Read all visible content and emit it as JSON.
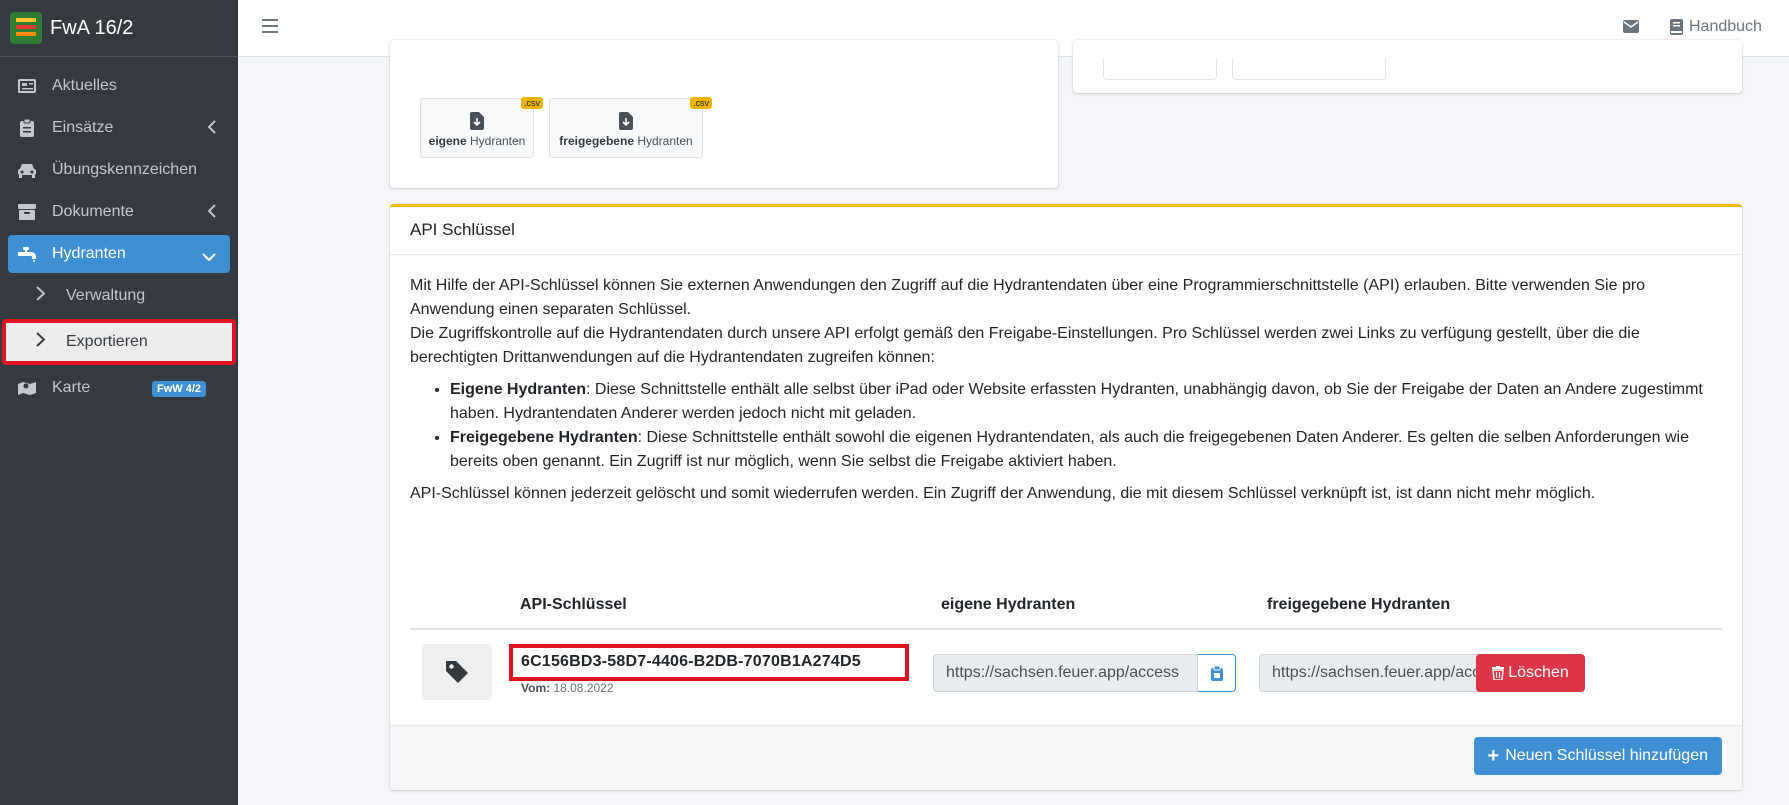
{
  "app": {
    "title": "FwA 16/2"
  },
  "sidebar": {
    "items": [
      {
        "label": "Aktuelles",
        "icon": "newspaper-icon"
      },
      {
        "label": "Einsätze",
        "icon": "clipboard-icon"
      },
      {
        "label": "Übungskennzeichen",
        "icon": "car-icon"
      },
      {
        "label": "Dokumente",
        "icon": "archive-icon"
      },
      {
        "label": "Hydranten",
        "icon": "faucet-icon"
      },
      {
        "label": "Verwaltung"
      },
      {
        "label": "Exportieren"
      },
      {
        "label": "Karte",
        "icon": "map-icon",
        "badge": "FwW 4/2"
      }
    ]
  },
  "topbar": {
    "handbuch": "Handbuch"
  },
  "downloads": {
    "own": {
      "bold": "eigene",
      "rest": " Hydranten",
      "badge": ".csv"
    },
    "shared": {
      "bold": "freigegebene",
      "rest": " Hydranten",
      "badge": ".csv"
    }
  },
  "api": {
    "title": "API Schlüssel",
    "p1": "Mit Hilfe der API-Schlüssel können Sie externen Anwendungen den Zugriff auf die Hydrantendaten über eine Programmierschnittstelle (API) erlauben. Bitte verwenden Sie pro Anwendung einen separaten Schlüssel.",
    "p2": "Die Zugriffskontrolle auf die Hydrantendaten durch unsere API erfolgt gemäß den Freigabe-Einstellungen. Pro Schlüssel werden zwei Links zu verfügung gestellt, über die die berechtigten Drittanwendungen auf die Hydrantendaten zugreifen können:",
    "li1_bold": "Eigene Hydranten",
    "li1_text": ": Diese Schnittstelle enthält alle selbst über iPad oder Website erfassten Hydranten, unabhängig davon, ob Sie der Freigabe der Daten an Andere zugestimmt haben. Hydrantendaten Anderer werden jedoch nicht mit geladen.",
    "li2_bold": "Freigegebene Hydranten",
    "li2_text": ": Diese Schnittstelle enthält sowohl die eigenen Hydrantendaten, als auch die freigegebenen Daten Anderer. Es gelten die selben Anforderungen wie bereits oben genannt. Ein Zugriff ist nur möglich, wenn Sie selbst die Freigabe aktiviert haben.",
    "p3": "API-Schlüssel können jederzeit gelöscht und somit wiederrufen werden. Ein Zugriff der Anwendung, die mit diesem Schlüssel verknüpft ist, ist dann nicht mehr möglich.",
    "table": {
      "headers": [
        "API-Schlüssel",
        "eigene Hydranten",
        "freigegebene Hydranten"
      ],
      "rows": [
        {
          "key": "6C156BD3-58D7-4406-B2DB-7070B1A274D5",
          "date_label": "Vom:",
          "date": "18.08.2022",
          "own_url": "https://sachsen.feuer.app/access",
          "shared_url": "https://sachsen.feuer.app/access",
          "delete_label": "Löschen"
        }
      ]
    },
    "add_label": "Neuen Schlüssel hinzufügen"
  },
  "colors": {
    "sidebar": "#343a40",
    "primary": "#3f8fd4",
    "danger": "#dc3545",
    "highlight": "#e0141e",
    "warning": "#f2b707"
  }
}
